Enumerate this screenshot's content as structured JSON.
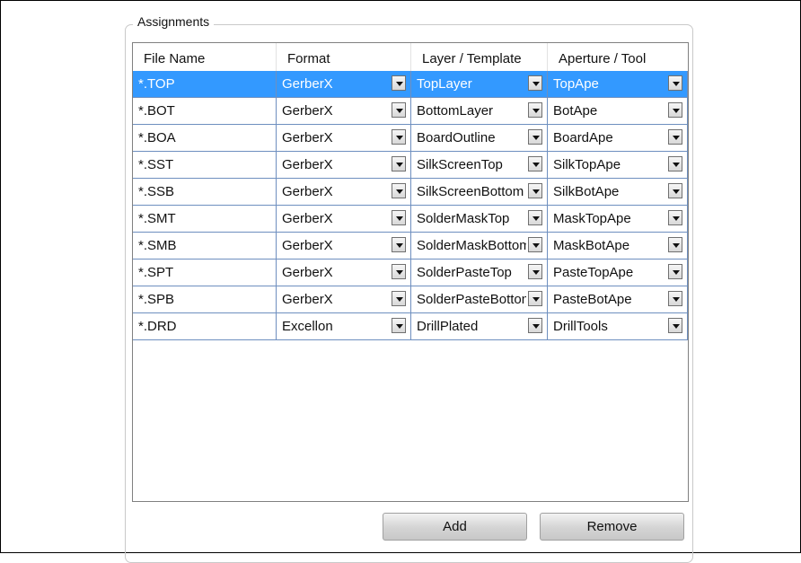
{
  "group_title": "Assignments",
  "columns": [
    "File Name",
    "Format",
    "Layer / Template",
    "Aperture / Tool"
  ],
  "rows": [
    {
      "file": "*.TOP",
      "format": "GerberX",
      "layer": "TopLayer",
      "aperture": "TopApe",
      "selected": true
    },
    {
      "file": "*.BOT",
      "format": "GerberX",
      "layer": "BottomLayer",
      "aperture": "BotApe"
    },
    {
      "file": "*.BOA",
      "format": "GerberX",
      "layer": "BoardOutline",
      "aperture": "BoardApe"
    },
    {
      "file": "*.SST",
      "format": "GerberX",
      "layer": "SilkScreenTop",
      "aperture": "SilkTopApe"
    },
    {
      "file": "*.SSB",
      "format": "GerberX",
      "layer": "SilkScreenBottom",
      "aperture": "SilkBotApe"
    },
    {
      "file": "*.SMT",
      "format": "GerberX",
      "layer": "SolderMaskTop",
      "aperture": "MaskTopApe"
    },
    {
      "file": "*.SMB",
      "format": "GerberX",
      "layer": "SolderMaskBottom",
      "aperture": "MaskBotApe"
    },
    {
      "file": "*.SPT",
      "format": "GerberX",
      "layer": "SolderPasteTop",
      "aperture": "PasteTopApe"
    },
    {
      "file": "*.SPB",
      "format": "GerberX",
      "layer": "SolderPasteBottom",
      "aperture": "PasteBotApe"
    },
    {
      "file": "*.DRD",
      "format": "Excellon",
      "layer": "DrillPlated",
      "aperture": "DrillTools"
    }
  ],
  "buttons": {
    "add": "Add",
    "remove": "Remove"
  },
  "colors": {
    "selection": "#3399ff",
    "grid_line": "#6e8fbf"
  }
}
